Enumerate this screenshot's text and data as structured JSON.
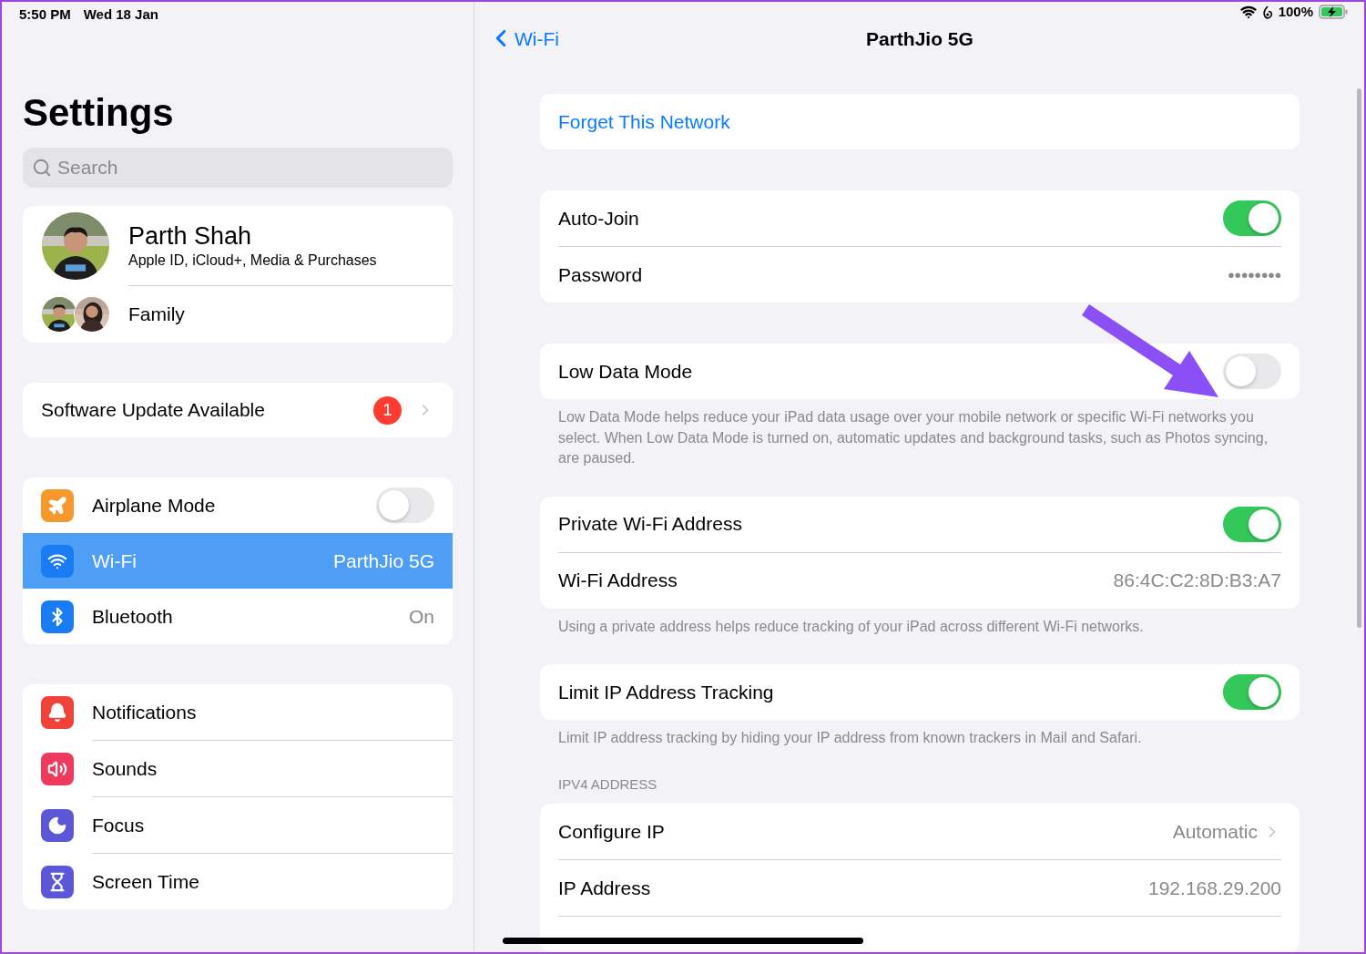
{
  "status_bar": {
    "time": "5:50 PM",
    "date": "Wed 18 Jan",
    "battery": "100%"
  },
  "sidebar": {
    "title": "Settings",
    "search": {
      "placeholder": "Search"
    },
    "profile": {
      "name": "Parth Shah",
      "subtitle": "Apple ID, iCloud+, Media & Purchases",
      "family": "Family"
    },
    "software_update": {
      "label": "Software Update Available",
      "badge": "1"
    },
    "groups": [
      [
        {
          "label": "Airplane Mode",
          "color": "#f7982c",
          "kind": "toggle",
          "on": false,
          "selected": false
        },
        {
          "label": "Wi-Fi",
          "color": "#1a7cf4",
          "kind": "value",
          "value": "ParthJio 5G",
          "selected": true
        },
        {
          "label": "Bluetooth",
          "color": "#1a7cf4",
          "kind": "value",
          "value": "On",
          "selected": false
        }
      ],
      [
        {
          "label": "Notifications",
          "color": "#f1423a",
          "kind": "plain",
          "selected": false
        },
        {
          "label": "Sounds",
          "color": "#ef3a5d",
          "kind": "plain",
          "selected": false
        },
        {
          "label": "Focus",
          "color": "#5b57d6",
          "kind": "plain",
          "selected": false
        },
        {
          "label": "Screen Time",
          "color": "#5b57d6",
          "kind": "plain",
          "selected": false
        }
      ]
    ]
  },
  "detail": {
    "back": "Wi-Fi",
    "title": "ParthJio 5G",
    "sections": [
      {
        "rows": [
          {
            "kind": "action",
            "label": "Forget This Network"
          }
        ]
      },
      {
        "rows": [
          {
            "kind": "toggle",
            "label": "Auto-Join",
            "on": true
          },
          {
            "kind": "value",
            "label": "Password",
            "value": "••••••••"
          }
        ]
      },
      {
        "rows": [
          {
            "kind": "toggle",
            "label": "Low Data Mode",
            "on": false
          }
        ],
        "footer": "Low Data Mode helps reduce your iPad data usage over your mobile network or specific Wi-Fi networks you select. When Low Data Mode is turned on, automatic updates and background tasks, such as Photos syncing, are paused."
      },
      {
        "rows": [
          {
            "kind": "toggle",
            "label": "Private Wi-Fi Address",
            "on": true
          },
          {
            "kind": "value",
            "label": "Wi-Fi Address",
            "value": "86:4C:C2:8D:B3:A7"
          }
        ],
        "footer": "Using a private address helps reduce tracking of your iPad across different Wi-Fi networks."
      },
      {
        "rows": [
          {
            "kind": "toggle",
            "label": "Limit IP Address Tracking",
            "on": true
          }
        ],
        "footer": "Limit IP address tracking by hiding your IP address from known trackers in Mail and Safari."
      },
      {
        "header": "IPV4 ADDRESS",
        "rows": [
          {
            "kind": "disclosure",
            "label": "Configure IP",
            "value": "Automatic"
          },
          {
            "kind": "value",
            "label": "IP Address",
            "value": "192.168.29.200"
          }
        ]
      }
    ]
  }
}
